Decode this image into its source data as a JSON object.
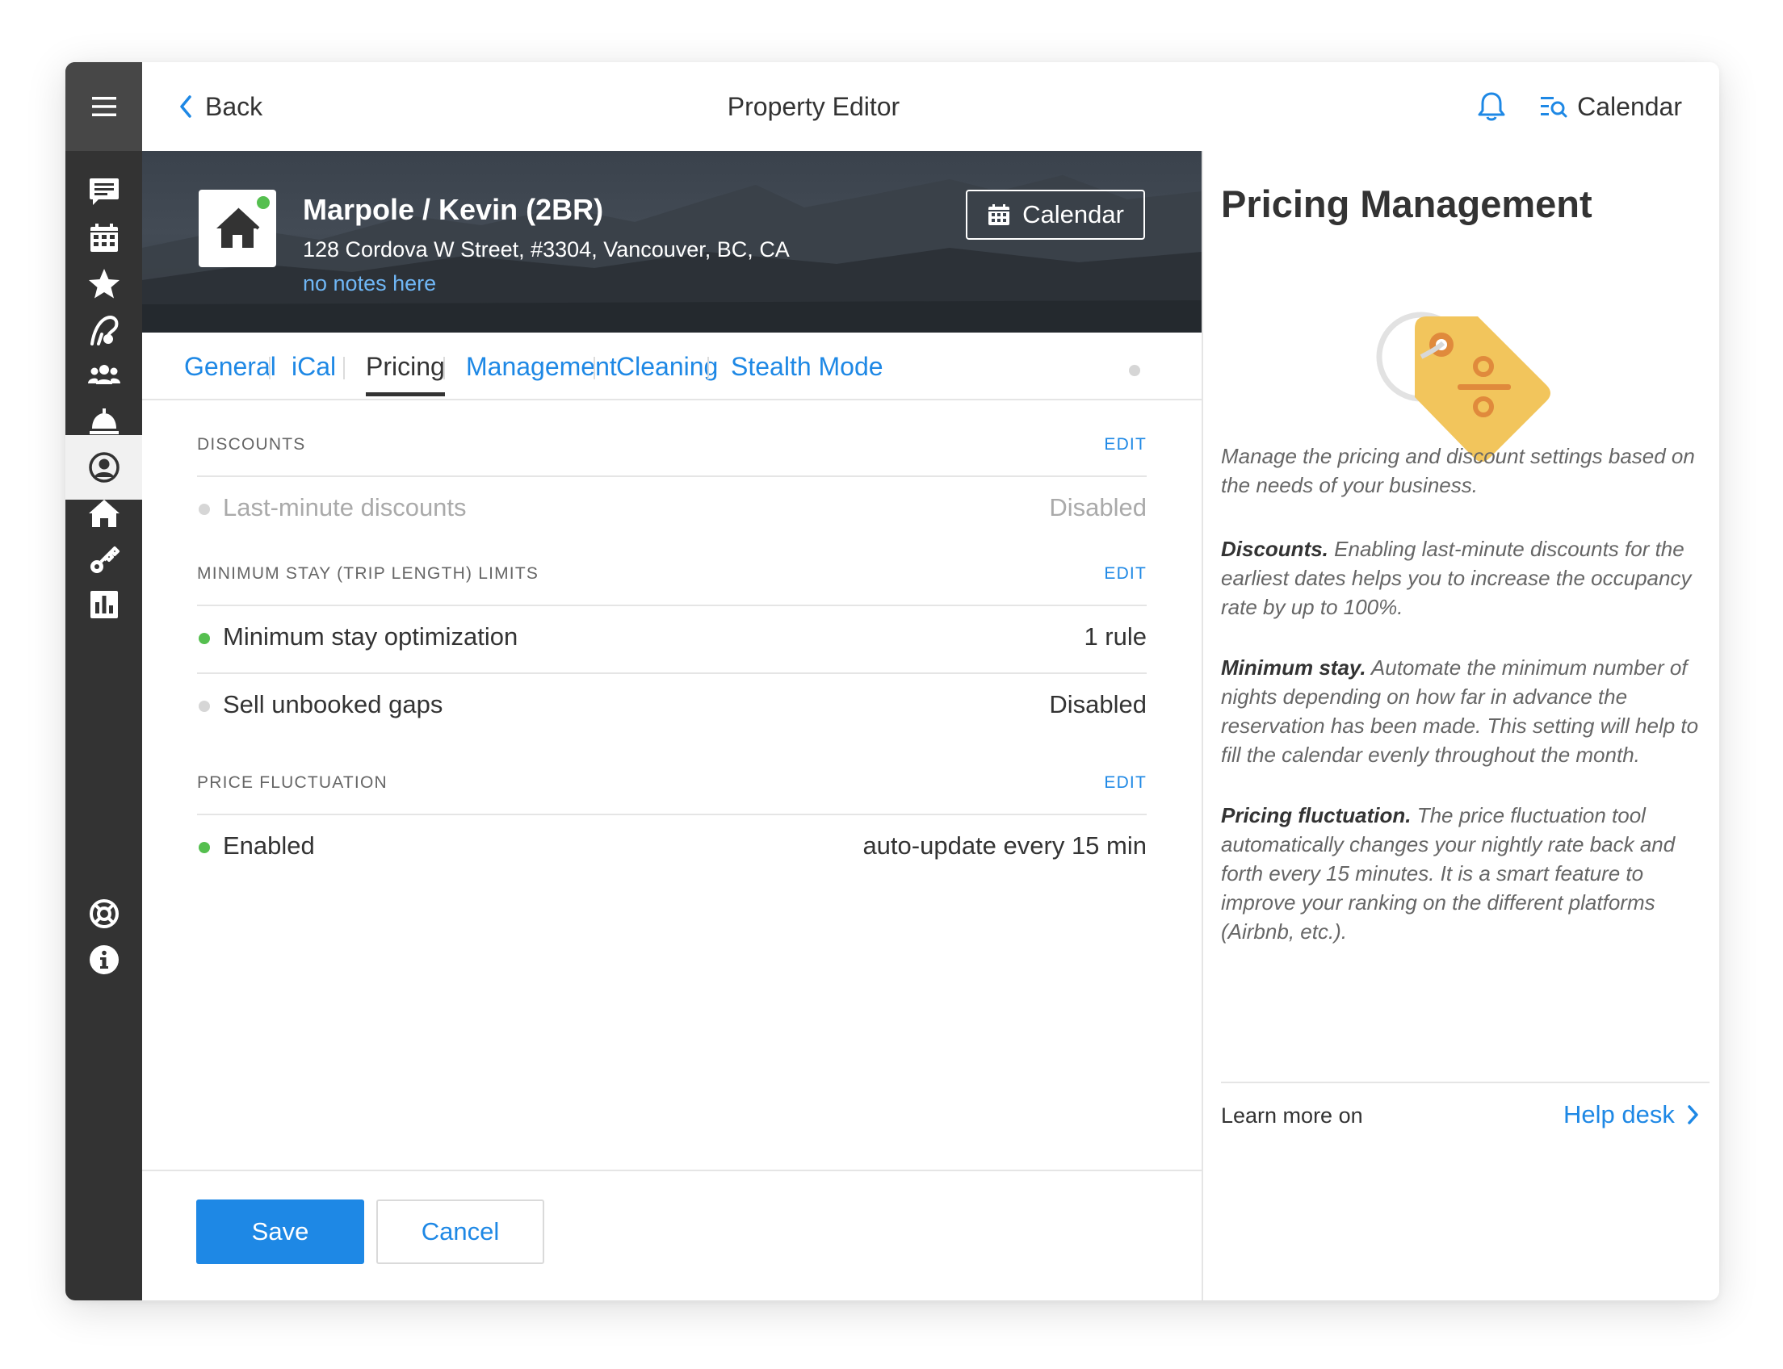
{
  "topbar": {
    "back_label": "Back",
    "title": "Property Editor",
    "calendar_label": "Calendar",
    "icons": [
      "hamburger-icon",
      "bell-icon",
      "calendar-search-icon"
    ]
  },
  "sidebar": {
    "items": [
      {
        "icon": "chat-icon"
      },
      {
        "icon": "calendar-icon"
      },
      {
        "icon": "star-icon"
      },
      {
        "icon": "brush-icon"
      },
      {
        "icon": "people-icon"
      },
      {
        "icon": "service-bell-icon"
      },
      {
        "icon": "user-circle-icon",
        "active": true
      },
      {
        "icon": "home-icon"
      },
      {
        "icon": "key-icon"
      },
      {
        "icon": "chart-icon"
      },
      {
        "icon": "lifebuoy-icon"
      },
      {
        "icon": "info-icon"
      }
    ]
  },
  "property": {
    "name": "Marpole / Kevin (2BR)",
    "address": "128 Cordova W Street, #3304, Vancouver, BC, CA",
    "notes": "no notes here",
    "calendar_button": "Calendar",
    "status_color": "#55bf4f"
  },
  "tabs": [
    {
      "label": "General"
    },
    {
      "label": "iCal"
    },
    {
      "label": "Pricing",
      "active": true
    },
    {
      "label": "Management"
    },
    {
      "label": "Cleaning"
    },
    {
      "label": "Stealth Mode"
    }
  ],
  "sections": {
    "discounts": {
      "title": "DISCOUNTS",
      "edit": "EDIT",
      "rows": [
        {
          "label": "Last-minute discounts",
          "value": "Disabled",
          "status": "off"
        }
      ]
    },
    "min_stay": {
      "title": "MINIMUM STAY (TRIP LENGTH) LIMITS",
      "edit": "EDIT",
      "rows": [
        {
          "label": "Minimum stay optimization",
          "value": "1 rule",
          "status": "on"
        },
        {
          "label": "Sell unbooked gaps",
          "value": "Disabled",
          "status": "off"
        }
      ]
    },
    "price_fluctuation": {
      "title": "PRICE FLUCTUATION",
      "edit": "EDIT",
      "rows": [
        {
          "label": "Enabled",
          "value": "auto-update every 15 min",
          "status": "on"
        }
      ]
    }
  },
  "footer": {
    "save_label": "Save",
    "cancel_label": "Cancel"
  },
  "panel": {
    "title": "Pricing Management",
    "intro": "Manage the pricing and discount settings based on the needs of your business.",
    "discounts_heading": "Discounts.",
    "discounts_text": "Enabling last-minute discounts for the earliest dates helps you to increase the occupancy rate by up to 100%.",
    "min_stay_heading": "Minimum stay.",
    "min_stay_text": "Automate the minimum number of nights depending on how far in advance the reservation has been made. This setting will help to fill the calendar evenly throughout the month.",
    "fluct_heading": "Pricing fluctuation.",
    "fluct_text": "The price fluctuation tool automatically changes your nightly rate back and forth every 15 minutes. It is a smart feature to improve your ranking on the different platforms (Airbnb, etc.).",
    "learn_more": "Learn more on",
    "help_link": "Help desk"
  },
  "colors": {
    "accent": "#1e88e5",
    "sidebar": "#333333",
    "status_on": "#55bf4f",
    "status_off": "#d6d6d6",
    "tag_yellow": "#f2c55c",
    "tag_orange": "#e08a3c"
  }
}
